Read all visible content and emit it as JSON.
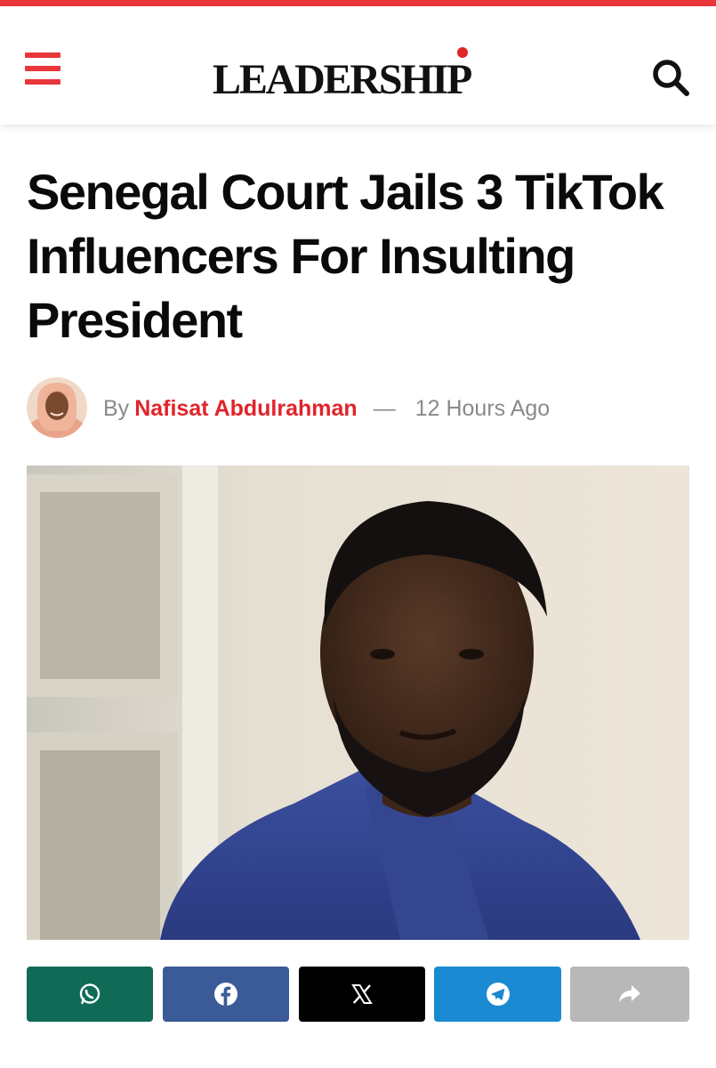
{
  "site": {
    "logo_text": "LEADERSHIP",
    "brand_color": "#e8363b"
  },
  "article": {
    "title": "Senegal Court Jails 3 TikTok Influencers For Insulting President",
    "by_label": "By",
    "author": "Nafisat Abdulrahman",
    "separator": "—",
    "time_ago": "12 Hours Ago"
  },
  "icons": {
    "menu": "hamburger-menu-icon",
    "search": "search-icon"
  },
  "share": [
    {
      "name": "whatsapp",
      "color": "#0f6b55",
      "icon": "whatsapp-icon"
    },
    {
      "name": "facebook",
      "color": "#3b5a98",
      "icon": "facebook-icon"
    },
    {
      "name": "x",
      "color": "#000000",
      "icon": "x-icon"
    },
    {
      "name": "telegram",
      "color": "#1a8ad2",
      "icon": "telegram-icon"
    },
    {
      "name": "share",
      "color": "#b8b8b8",
      "icon": "share-arrow-icon"
    }
  ]
}
